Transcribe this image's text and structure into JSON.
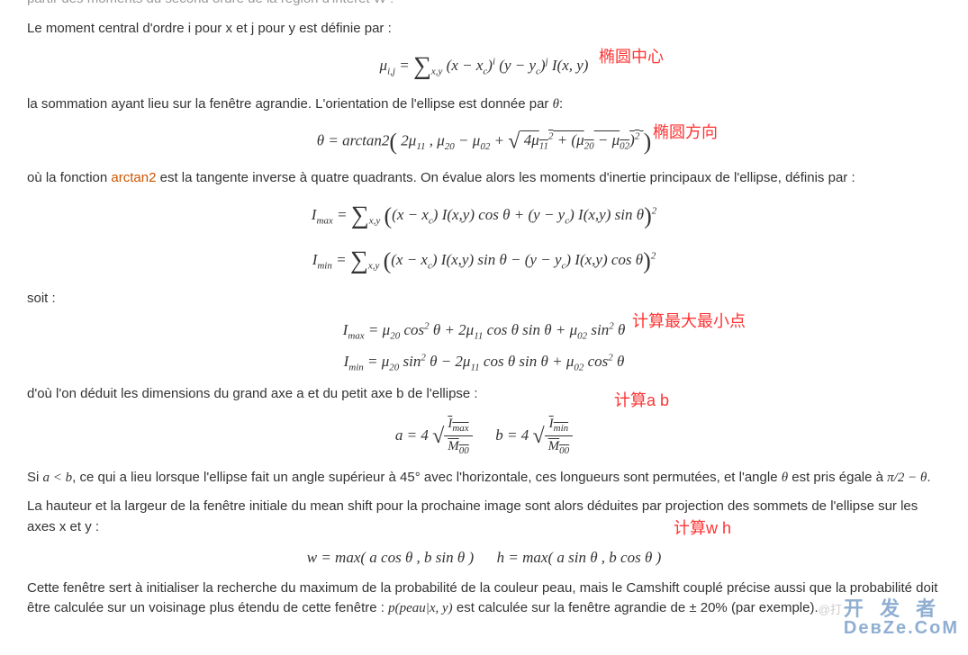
{
  "text": {
    "p0_cut": "partir des moments du second ordre de la région d'intérêt W :",
    "p1": "Le moment central d'ordre i pour x et j pour y est définie par :",
    "eq1": "μ<sub>i,j</sub> = <span class='sum'>∑</span><sub class='sub'>x,y</sub> (x − x<sub>c</sub>)<sup>i</sup> (y − y<sub>c</sub>)<sup>j</sup> I(x, y)",
    "p2_a": "la sommation ayant lieu sur la fenêtre agrandie. L'orientation de l'ellipse est donnée par ",
    "p2_theta": "θ",
    "p2_b": ":",
    "eq2": "θ = arctan2<span class='big-paren'>(</span> 2μ<sub>11</sub> , μ<sub>20</sub> − μ<sub>02</sub> + <span class='sqrt-sym'>√</span><span class='sqrt'> 4μ<sub>11</sub><sup>2</sup> + (μ<sub>20</sub> − μ<sub>02</sub>)<sup>2</sup> </span> <span class='big-paren'>)</span>",
    "p3_a": "où la fonction ",
    "p3_link": "arctan2",
    "p3_b": " est la tangente inverse à quatre quadrants. On évalue alors les moments d'inertie principaux de l'ellipse, définis par :",
    "eq3a": "I<sub>max</sub> = <span class='sum'>∑</span><sub class='sub'>x,y</sub> <span class='big-paren'>(</span>(x − x<sub>c</sub>) I(x,y) cos θ + (y − y<sub>c</sub>) I(x,y) sin θ<span class='big-paren'>)</span><sup>2</sup>",
    "eq3b": "I<sub>min</sub> = <span class='sum'>∑</span><sub class='sub'>x,y</sub> <span class='big-paren'>(</span>(x − x<sub>c</sub>) I(x,y) sin θ − (y − y<sub>c</sub>) I(x,y) cos θ<span class='big-paren'>)</span><sup>2</sup>",
    "p4": "soit :",
    "eq4a": "I<sub>max</sub> = μ<sub>20</sub> cos<sup>2</sup> θ + 2μ<sub>11</sub> cos θ sin θ + μ<sub>02</sub> sin<sup>2</sup> θ",
    "eq4b": "I<sub>min</sub> = μ<sub>20</sub> sin<sup>2</sup> θ − 2μ<sub>11</sub> cos θ sin θ + μ<sub>02</sub> cos<sup>2</sup> θ",
    "p5": "d'où l'on déduit les dimensions du grand axe a et du petit axe b de l'ellipse :",
    "eq5": "a = 4 <span class='sqrt-sym'>√</span><span class='frac sqrt'><span class='num'>I<sub>max</sub></span><span class='den'>M<sub>00</sub></span></span> &nbsp;&nbsp;&nbsp;&nbsp; b = 4 <span class='sqrt-sym'>√</span><span class='frac sqrt'><span class='num'>I<sub>min</sub></span><span class='den'>M<sub>00</sub></span></span>",
    "p6_a": "Si ",
    "p6_math1": "a < b",
    "p6_b": ", ce qui a lieu lorsque l'ellipse fait un angle supérieur à 45° avec l'horizontale, ces longueurs sont permutées, et l'angle ",
    "p6_math2": "θ",
    "p6_c": " est pris égale à ",
    "p6_math3": "π/2 − θ",
    "p6_d": ".",
    "p7": "La hauteur et la largeur de la fenêtre initiale du mean shift pour la prochaine image sont alors déduites par projection des sommets de l'ellipse sur les axes x et y :",
    "eq6": "w = max( a cos θ , b sin θ ) &nbsp;&nbsp;&nbsp;&nbsp; h = max( a sin θ , b cos θ )",
    "p8_a": "Cette fenêtre sert à initialiser la recherche du maximum de la probabilité de la couleur peau, mais le Camshift couplé précise aussi que la probabilité doit être calculée sur un voisinage plus étendu de cette fenêtre : ",
    "p8_math": "p(peau|x, y)",
    "p8_b": " est calculée sur la fenêtre agrandie de ± 20% (par exemple)."
  },
  "annotations": {
    "a1": "椭圆中心",
    "a2": "椭圆方向",
    "a3": "计算最大最小点",
    "a4": "计算a b",
    "a5": "计算w h"
  },
  "watermark": {
    "at": "@打",
    "line1": "开 发 者",
    "line2": "DевZе.СоМ"
  }
}
